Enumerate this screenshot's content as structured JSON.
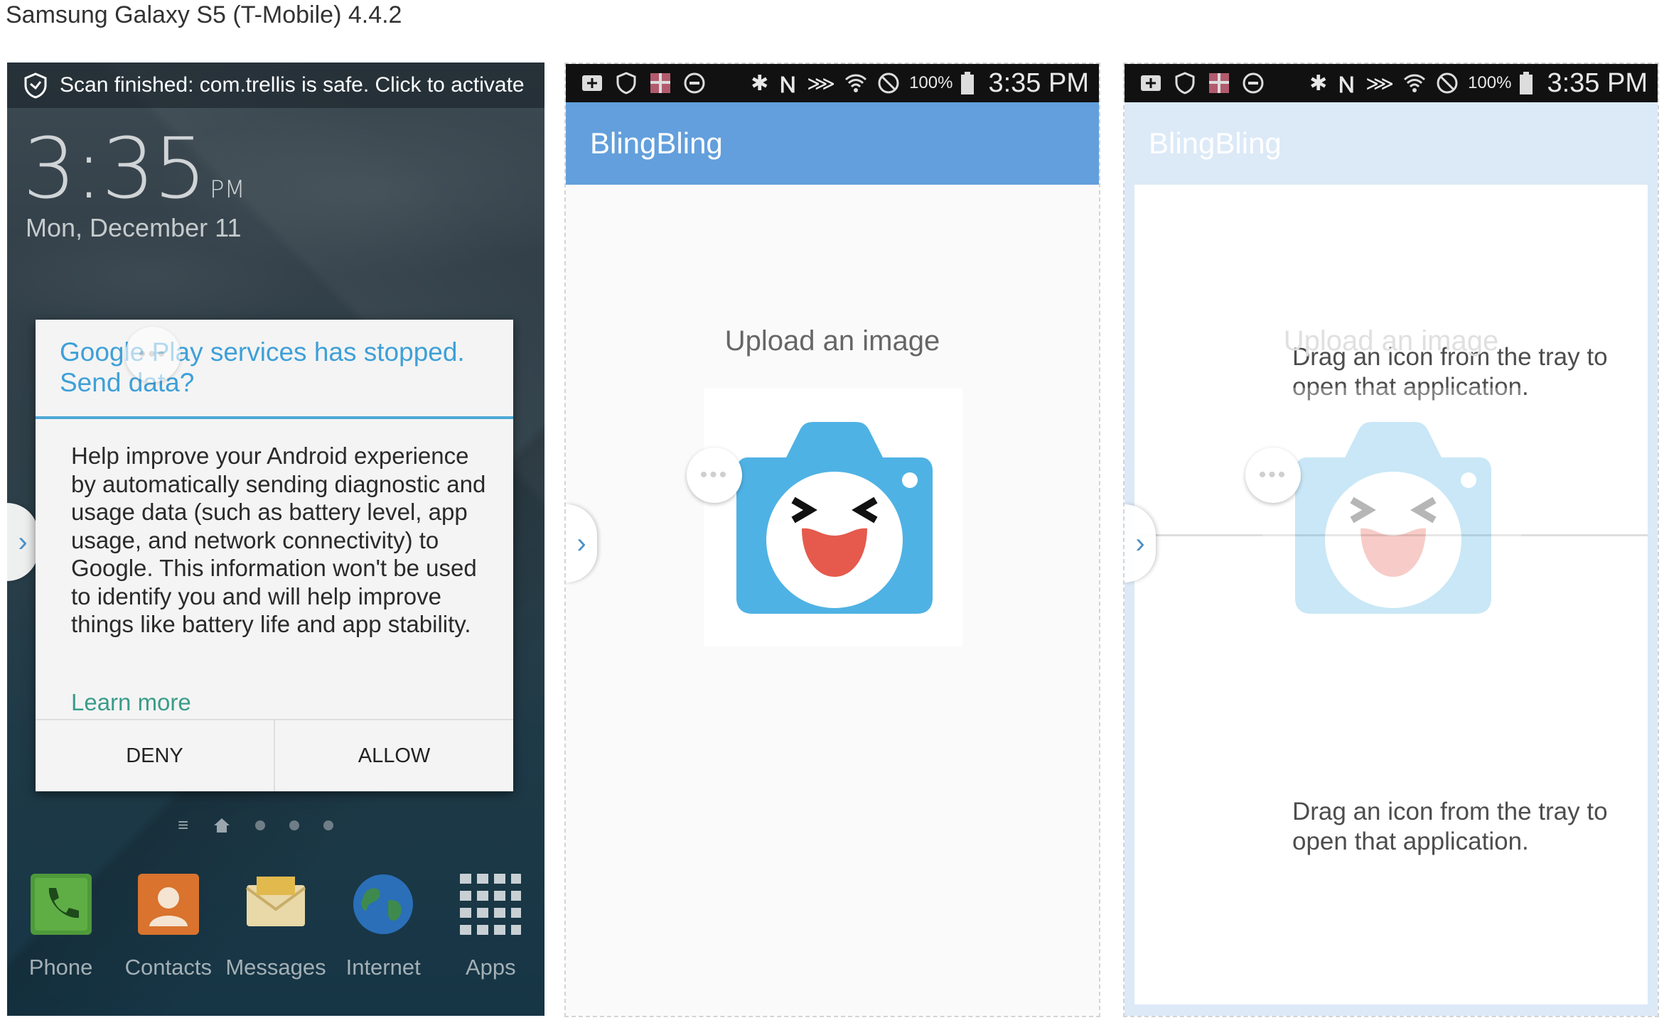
{
  "page": {
    "title": "Samsung Galaxy S5 (T-Mobile) 4.4.2"
  },
  "colors": {
    "accent": "#629fdc",
    "dialog_title": "#3ea0d8",
    "link": "#3a9c8a",
    "camera": "#4fb2e4"
  },
  "lockscreen": {
    "notification": "Scan finished: com.trellis is safe. Click to activate",
    "clock": "3:35",
    "ampm": "PM",
    "date": "Mon, December 11",
    "dialog": {
      "title": "Google Play services has stopped. Send data?",
      "body": "Help improve your Android experience by automatically sending diagnostic and usage data (such as battery level, app usage, and network connectivity) to Google. This information won't be used to identify you and will help improve things like battery life and app stability.",
      "link": "Learn more",
      "deny": "DENY",
      "allow": "ALLOW"
    },
    "dock": [
      {
        "label": "Phone",
        "icon": "phone-icon"
      },
      {
        "label": "Contacts",
        "icon": "contacts-icon"
      },
      {
        "label": "Messages",
        "icon": "messages-icon"
      },
      {
        "label": "Internet",
        "icon": "globe-icon"
      },
      {
        "label": "Apps",
        "icon": "apps-grid-icon"
      }
    ]
  },
  "statusbar": {
    "battery": "100%",
    "time": "3:35 PM"
  },
  "app": {
    "title": "BlingBling",
    "upload_label": "Upload an image",
    "hint": "Drag an icon from the tray to open that application."
  }
}
